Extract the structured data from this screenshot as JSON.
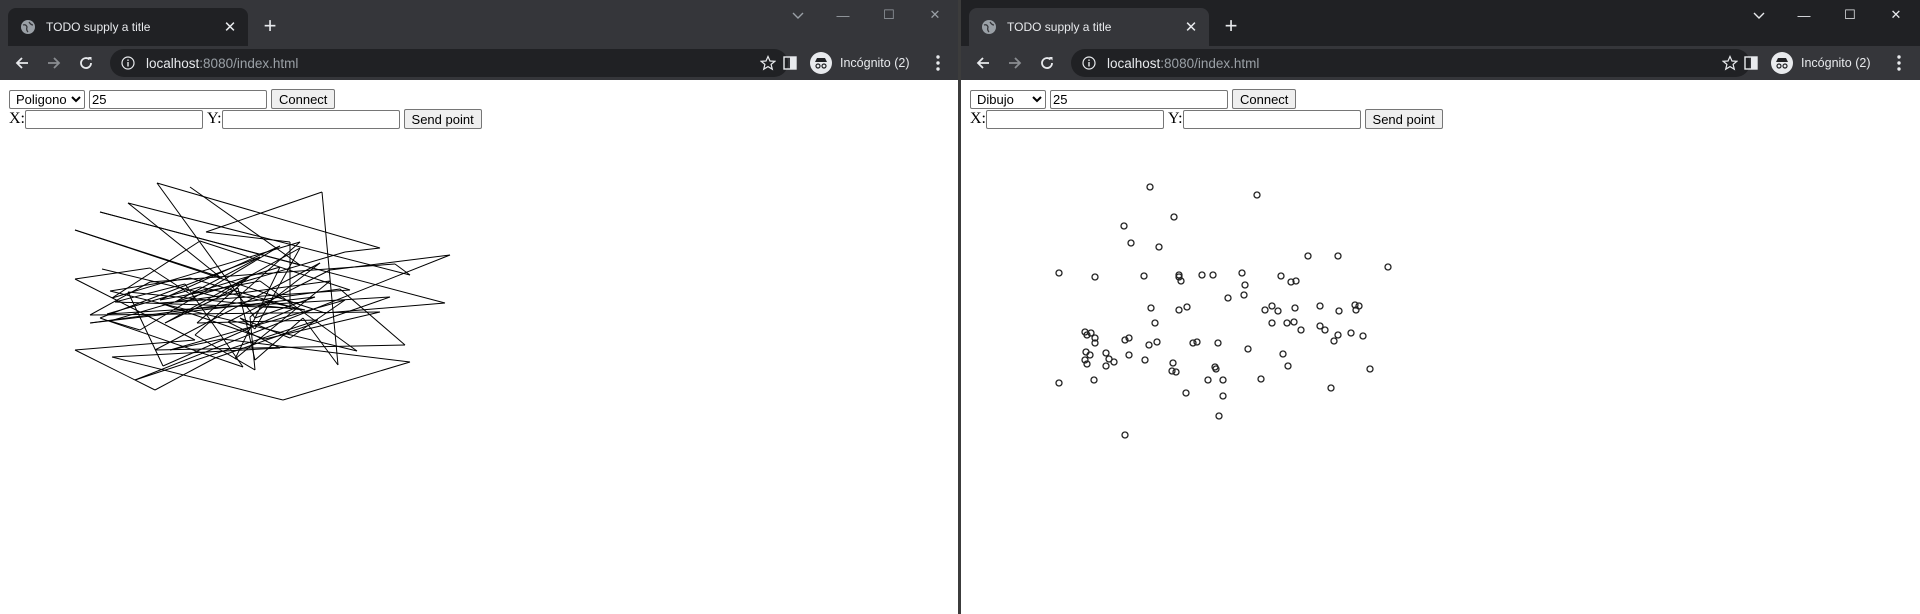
{
  "windows": [
    {
      "tab_title": "TODO supply a title",
      "url_host": "localhost",
      "url_path": ":8080/index.html",
      "incognito_label": "Incógnito (2)",
      "mode_options": [
        "Poligono",
        "Dibujo"
      ],
      "mode_selected": "Poligono",
      "value_input": "25",
      "connect_label": "Connect",
      "x_label": "X:",
      "y_label": "Y:",
      "x_value": "",
      "y_value": "",
      "send_label": "Send point"
    },
    {
      "tab_title": "TODO supply a title",
      "url_host": "localhost",
      "url_path": ":8080/index.html",
      "incognito_label": "Incógnito (2)",
      "mode_options": [
        "Poligono",
        "Dibujo"
      ],
      "mode_selected": "Dibujo",
      "value_input": "25",
      "connect_label": "Connect",
      "x_label": "X:",
      "y_label": "Y:",
      "x_value": "",
      "y_value": "",
      "send_label": "Send point"
    }
  ],
  "chart_data": [
    {
      "type": "line",
      "points": [
        [
          190,
          107
        ],
        [
          300,
          185
        ],
        [
          100,
          132
        ],
        [
          445,
          223
        ],
        [
          325,
          233
        ],
        [
          75,
          150
        ],
        [
          220,
          197
        ],
        [
          128,
          123
        ],
        [
          410,
          195
        ],
        [
          395,
          184
        ],
        [
          150,
          202
        ],
        [
          90,
          235
        ],
        [
          380,
          232
        ],
        [
          265,
          259
        ],
        [
          160,
          223
        ],
        [
          350,
          210
        ],
        [
          200,
          161
        ],
        [
          112,
          218
        ],
        [
          300,
          162
        ],
        [
          195,
          255
        ],
        [
          255,
          290
        ],
        [
          250,
          237
        ],
        [
          320,
          183
        ],
        [
          155,
          270
        ],
        [
          405,
          265
        ],
        [
          340,
          209
        ],
        [
          90,
          243
        ],
        [
          315,
          217
        ],
        [
          255,
          238
        ],
        [
          157,
          103
        ],
        [
          380,
          168
        ],
        [
          345,
          172
        ],
        [
          110,
          241
        ],
        [
          140,
          250
        ],
        [
          280,
          166
        ],
        [
          160,
          220
        ],
        [
          260,
          201
        ],
        [
          357,
          271
        ],
        [
          110,
          211
        ],
        [
          190,
          198
        ],
        [
          295,
          228
        ],
        [
          163,
          286
        ],
        [
          128,
          212
        ],
        [
          305,
          230
        ],
        [
          200,
          207
        ],
        [
          107,
          234
        ],
        [
          390,
          217
        ],
        [
          215,
          278
        ],
        [
          155,
          310
        ],
        [
          75,
          270
        ],
        [
          195,
          260
        ],
        [
          75,
          199
        ],
        [
          150,
          188
        ],
        [
          190,
          214
        ],
        [
          280,
          187
        ],
        [
          235,
          279
        ],
        [
          330,
          201
        ],
        [
          175,
          222
        ],
        [
          260,
          177
        ],
        [
          100,
          238
        ],
        [
          243,
          287
        ],
        [
          185,
          204
        ],
        [
          115,
          222
        ],
        [
          290,
          228
        ],
        [
          290,
          162
        ],
        [
          206,
          152
        ],
        [
          322,
          112
        ],
        [
          338,
          285
        ],
        [
          303,
          238
        ],
        [
          255,
          280
        ],
        [
          238,
          208
        ],
        [
          165,
          243
        ],
        [
          300,
          168
        ],
        [
          255,
          249
        ],
        [
          240,
          238
        ],
        [
          290,
          258
        ],
        [
          345,
          220
        ],
        [
          170,
          270
        ],
        [
          222,
          259
        ],
        [
          410,
          282
        ],
        [
          283,
          320
        ],
        [
          112,
          277
        ],
        [
          280,
          268
        ],
        [
          228,
          242
        ],
        [
          330,
          190
        ],
        [
          450,
          175
        ],
        [
          135,
          300
        ],
        [
          318,
          240
        ],
        [
          197,
          243
        ],
        [
          250,
          196
        ],
        [
          218,
          217
        ],
        [
          102,
          189
        ]
      ]
    },
    {
      "type": "scatter",
      "points": [
        [
          189,
          107
        ],
        [
          296,
          115
        ],
        [
          163,
          146
        ],
        [
          213,
          137
        ],
        [
          170,
          163
        ],
        [
          198,
          167
        ],
        [
          320,
          196
        ],
        [
          98,
          193
        ],
        [
          134,
          197
        ],
        [
          183,
          196
        ],
        [
          218,
          195
        ],
        [
          241,
          195
        ],
        [
          218,
          197
        ],
        [
          252,
          195
        ],
        [
          281,
          193
        ],
        [
          347,
          176
        ],
        [
          377,
          176
        ],
        [
          427,
          187
        ],
        [
          220,
          201
        ],
        [
          335,
          201
        ],
        [
          284,
          205
        ],
        [
          330,
          202
        ],
        [
          267,
          218
        ],
        [
          190,
          228
        ],
        [
          226,
          227
        ],
        [
          218,
          230
        ],
        [
          311,
          226
        ],
        [
          304,
          230
        ],
        [
          283,
          215
        ],
        [
          317,
          231
        ],
        [
          334,
          228
        ],
        [
          359,
          226
        ],
        [
          378,
          231
        ],
        [
          394,
          225
        ],
        [
          395,
          230
        ],
        [
          398,
          226
        ],
        [
          194,
          243
        ],
        [
          333,
          242
        ],
        [
          359,
          246
        ],
        [
          364,
          250
        ],
        [
          377,
          255
        ],
        [
          326,
          243
        ],
        [
          311,
          243
        ],
        [
          390,
          253
        ],
        [
          340,
          250
        ],
        [
          196,
          262
        ],
        [
          164,
          260
        ],
        [
          168,
          258
        ],
        [
          236,
          262
        ],
        [
          188,
          265
        ],
        [
          124,
          252
        ],
        [
          130,
          253
        ],
        [
          126,
          255
        ],
        [
          134,
          258
        ],
        [
          134,
          263
        ],
        [
          129,
          275
        ],
        [
          126,
          284
        ],
        [
          124,
          280
        ],
        [
          125,
          272
        ],
        [
          145,
          273
        ],
        [
          148,
          279
        ],
        [
          145,
          286
        ],
        [
          153,
          282
        ],
        [
          168,
          275
        ],
        [
          184,
          280
        ],
        [
          212,
          283
        ],
        [
          211,
          291
        ],
        [
          215,
          292
        ],
        [
          232,
          263
        ],
        [
          257,
          263
        ],
        [
          255,
          289
        ],
        [
          254,
          287
        ],
        [
          247,
          300
        ],
        [
          262,
          300
        ],
        [
          287,
          269
        ],
        [
          322,
          274
        ],
        [
          327,
          286
        ],
        [
          300,
          299
        ],
        [
          373,
          261
        ],
        [
          402,
          256
        ],
        [
          409,
          289
        ],
        [
          370,
          308
        ],
        [
          98,
          303
        ],
        [
          133,
          300
        ],
        [
          225,
          313
        ],
        [
          262,
          316
        ],
        [
          258,
          336
        ],
        [
          164,
          355
        ]
      ]
    }
  ]
}
